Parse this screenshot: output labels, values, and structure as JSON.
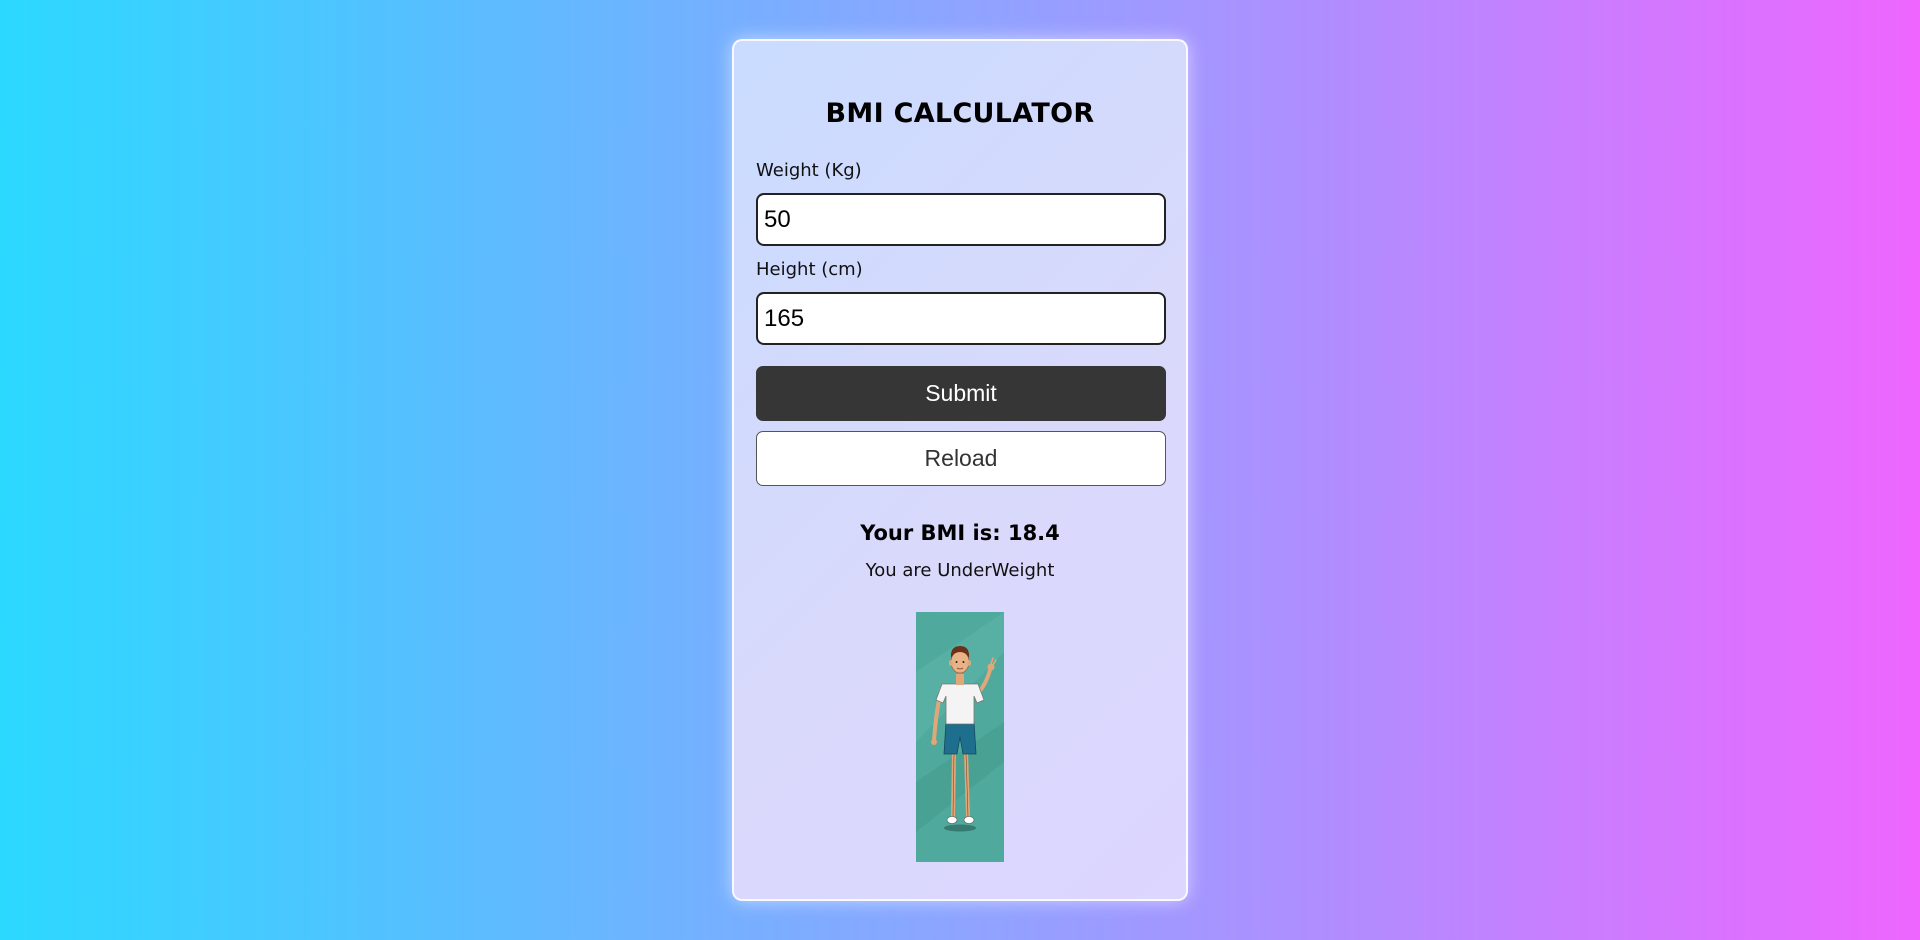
{
  "app": {
    "title": "BMI CALCULATOR"
  },
  "form": {
    "weight_label": "Weight (Kg)",
    "weight_value": "50",
    "height_label": "Height (cm)",
    "height_value": "165",
    "submit_label": "Submit",
    "reload_label": "Reload"
  },
  "result": {
    "bmi_text": "Your BMI is: 18.4",
    "bmi_value": 18.4,
    "status_text": "You are UnderWeight"
  },
  "illustration": {
    "icon": "underweight-person-waving-illustration"
  },
  "colors": {
    "submit_bg": "#363636",
    "illustration_bg": "#4fa99c"
  }
}
